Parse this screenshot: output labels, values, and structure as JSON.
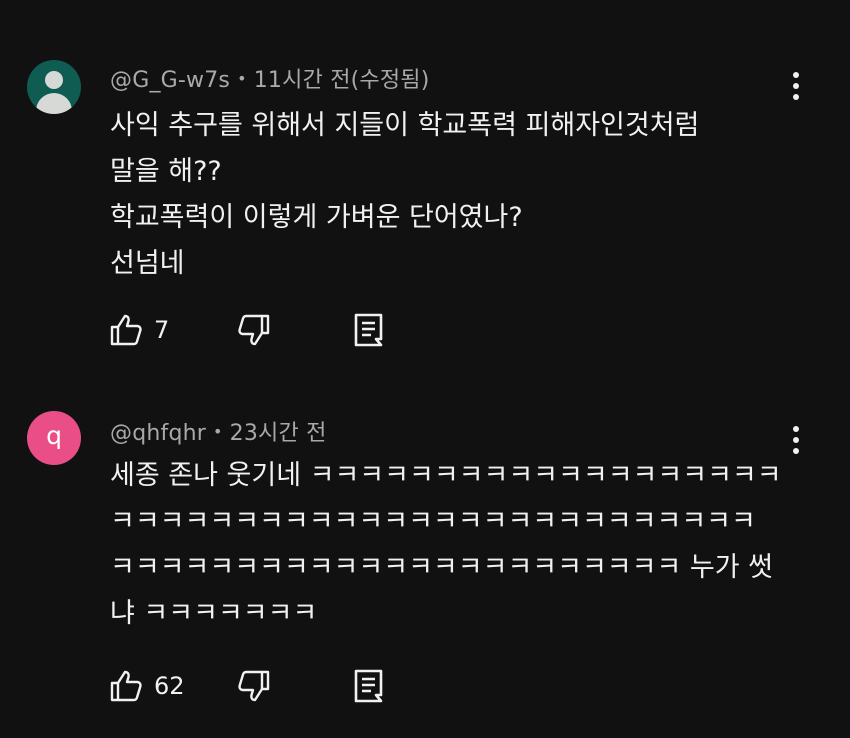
{
  "comments": [
    {
      "author": "@G_G-w7s",
      "separator": "•",
      "time": "11시간 전(수정됨)",
      "avatar_type": "default-person",
      "avatar_color": "#0f5d52",
      "lines": [
        "사익 추구를 위해서 지들이 학교폭력 피해자인것처럼",
        "말을 해??",
        "학교폭력이 이렇게 가벼운 단어였나?",
        "선넘네"
      ],
      "likes": "7"
    },
    {
      "author": "@qhfqhr",
      "separator": "•",
      "time": "23시간 전",
      "avatar_letter": "q",
      "avatar_color": "#e94f86",
      "lines": [
        "세종 존나 웃기네 ㅋㅋㅋㅋㅋㅋㅋㅋㅋㅋㅋㅋㅋㅋㅋㅋㅋㅋㅋ",
        "ㅋㅋㅋㅋㅋㅋㅋㅋㅋㅋㅋㅋㅋㅋㅋㅋㅋㅋㅋㅋㅋㅋㅋㅋㅋㅋ",
        "ㅋㅋㅋㅋㅋㅋㅋㅋㅋㅋㅋㅋㅋㅋㅋㅋㅋㅋㅋㅋㅋㅋㅋ 누가 썻",
        "냐 ㅋㅋㅋㅋㅋㅋㅋ"
      ],
      "likes": "62"
    }
  ],
  "icons": {
    "like": "thumbs-up-icon",
    "dislike": "thumbs-down-icon",
    "reply": "reply-icon",
    "menu": "more-vert-icon"
  }
}
